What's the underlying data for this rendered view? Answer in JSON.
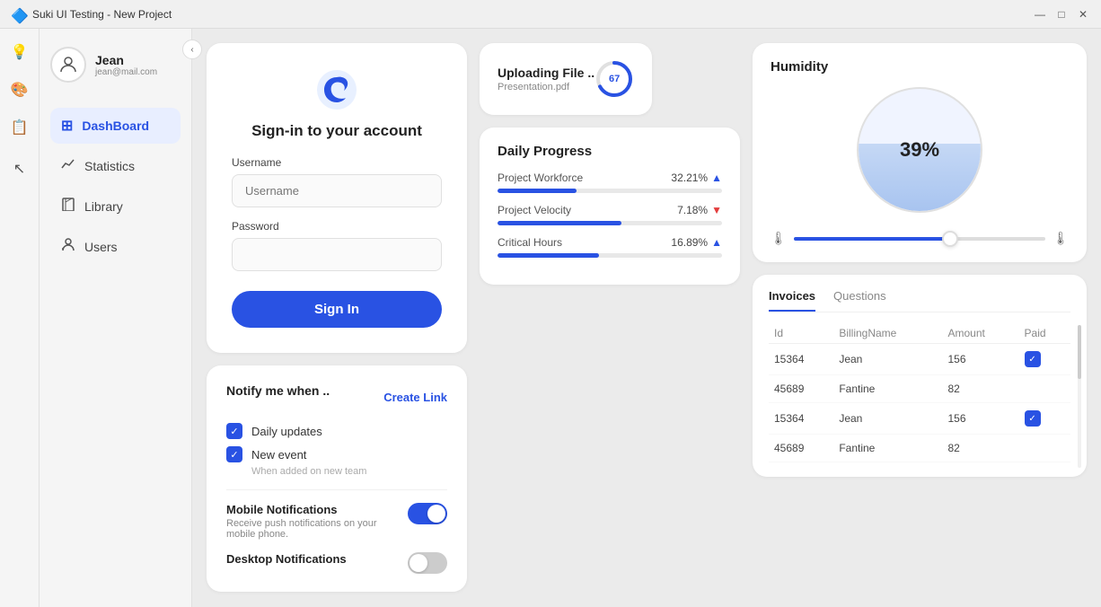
{
  "titlebar": {
    "title": "Suki UI Testing - New Project",
    "min_label": "—",
    "max_label": "□",
    "close_label": "✕"
  },
  "toolbar": {
    "icons": [
      "💡",
      "🎨",
      "📋"
    ]
  },
  "sidebar": {
    "collapse_icon": "‹",
    "user": {
      "name": "Jean",
      "email": "jean@mail.com"
    },
    "nav_items": [
      {
        "id": "dashboard",
        "label": "DashBoard",
        "icon": "⊞",
        "active": true
      },
      {
        "id": "statistics",
        "label": "Statistics",
        "icon": "📈",
        "active": false
      },
      {
        "id": "library",
        "label": "Library",
        "icon": "🔖",
        "active": false
      },
      {
        "id": "users",
        "label": "Users",
        "icon": "👤",
        "active": false
      }
    ]
  },
  "signin_card": {
    "title": "Sign-in to your account",
    "username_label": "Username",
    "username_placeholder": "Username",
    "password_label": "Password",
    "password_placeholder": "",
    "button_label": "Sign In"
  },
  "upload_card": {
    "title": "Uploading File ..",
    "subtitle": "Presentation.pdf",
    "progress": 67
  },
  "daily_progress": {
    "title": "Daily Progress",
    "items": [
      {
        "label": "Project Workforce",
        "value": "32.21%",
        "direction": "up",
        "fill": 35
      },
      {
        "label": "Project Velocity",
        "value": "7.18%",
        "direction": "down",
        "fill": 55
      },
      {
        "label": "Critical Hours",
        "value": "16.89%",
        "direction": "up",
        "fill": 45
      }
    ]
  },
  "humidity_card": {
    "title": "Humidity",
    "percentage": "39%"
  },
  "notify_card": {
    "title": "Notify me when ..",
    "checkboxes": [
      {
        "label": "Daily updates",
        "checked": true
      },
      {
        "label": "New event",
        "checked": true
      }
    ],
    "when_added": "When added on new team",
    "create_link": "Create Link",
    "mobile_notifications": {
      "title": "Mobile Notifications",
      "desc": "Receive push notifications on your mobile phone.",
      "enabled": true
    },
    "desktop_notifications": {
      "title": "Desktop Notifications",
      "enabled": false
    }
  },
  "invoices_card": {
    "tabs": [
      "Invoices",
      "Questions"
    ],
    "active_tab": "Invoices",
    "columns": [
      "Id",
      "BillingName",
      "Amount",
      "Paid"
    ],
    "rows": [
      {
        "id": "15364",
        "name": "Jean",
        "amount": "156",
        "paid": true
      },
      {
        "id": "45689",
        "name": "Fantine",
        "amount": "82",
        "paid": false
      },
      {
        "id": "15364",
        "name": "Jean",
        "amount": "156",
        "paid": true
      },
      {
        "id": "45689",
        "name": "Fantine",
        "amount": "82",
        "paid": false
      }
    ]
  }
}
